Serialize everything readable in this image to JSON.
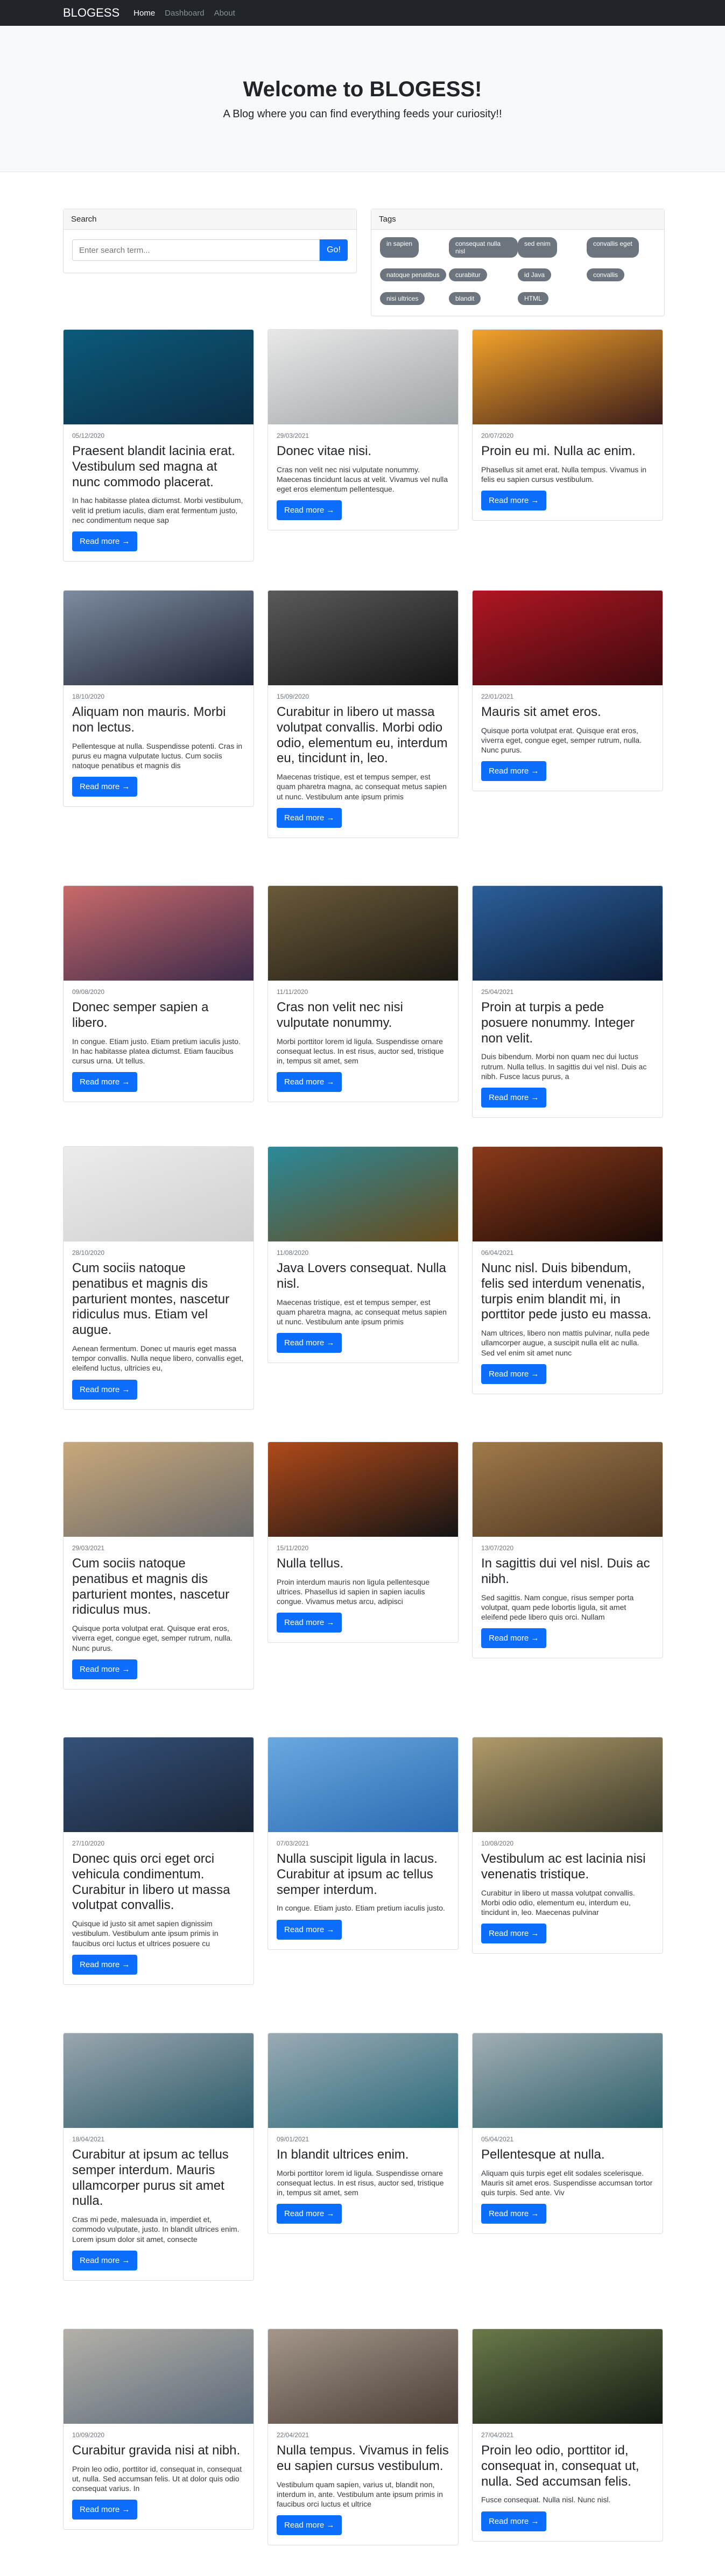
{
  "nav": {
    "brand": "BLOGESS",
    "links": [
      "Home",
      "Dashboard",
      "About"
    ]
  },
  "hero": {
    "title": "Welcome to BLOGESS!",
    "subtitle": "A Blog where you can find everything feeds your curiosity!!"
  },
  "search": {
    "header": "Search",
    "placeholder": "Enter search term...",
    "button": "Go!"
  },
  "tags": {
    "header": "Tags",
    "items": [
      "in sapien",
      "consequat nulla nisl",
      "sed enim",
      "convallis eget",
      "natoque penatibus",
      "curabitur",
      "id Java",
      "convallis",
      "nisi ultrices",
      "blandit",
      "HTML"
    ]
  },
  "read_more_label": "Read more →",
  "posts": [
    {
      "date": "05/12/2020",
      "title": "Praesent blandit lacinia erat. Vestibulum sed magna at nunc commodo placerat.",
      "excerpt": "In hac habitasse platea dictumst. Morbi vestibulum, velit id pretium iaculis, diam erat fermentum justo, nec condimentum neque sap",
      "colors": [
        "#0b5a7a",
        "#0c2e46"
      ]
    },
    {
      "date": "29/03/2021",
      "title": "Donec vitae nisi.",
      "excerpt": "Cras non velit nec nisi vulputate nonummy. Maecenas tincidunt lacus at velit. Vivamus vel nulla eget eros elementum pellentesque.",
      "colors": [
        "#e8e8e8",
        "#9ea3a6"
      ]
    },
    {
      "date": "20/07/2020",
      "title": "Proin eu mi. Nulla ac enim.",
      "excerpt": "Phasellus sit amet erat. Nulla tempus. Vivamus in felis eu sapien cursus vestibulum.",
      "colors": [
        "#f4a32a",
        "#3a1c1a"
      ]
    },
    {
      "date": "18/10/2020",
      "title": "Aliquam non mauris. Morbi non lectus.",
      "excerpt": "Pellentesque at nulla. Suspendisse potenti. Cras in purus eu magna vulputate luctus. Cum sociis natoque penatibus et magnis dis",
      "colors": [
        "#7d8ba0",
        "#1e2534"
      ]
    },
    {
      "date": "15/09/2020",
      "title": "Curabitur in libero ut massa volutpat convallis. Morbi odio odio, elementum eu, interdum eu, tincidunt in, leo.",
      "excerpt": "Maecenas tristique, est et tempus semper, est quam pharetra magna, ac consequat metus sapien ut nunc. Vestibulum ante ipsum primis",
      "colors": [
        "#5a5a5a",
        "#141414"
      ]
    },
    {
      "date": "22/01/2021",
      "title": "Mauris sit amet eros.",
      "excerpt": "Quisque porta volutpat erat. Quisque erat eros, viverra eget, congue eget, semper rutrum, nulla. Nunc purus.",
      "colors": [
        "#b01622",
        "#3c0a0e"
      ]
    },
    {
      "date": "09/08/2020",
      "title": "Donec semper sapien a libero.",
      "excerpt": "In congue. Etiam justo. Etiam pretium iaculis justo. In hac habitasse platea dictumst. Etiam faucibus cursus urna. Ut tellus.",
      "colors": [
        "#c96a6a",
        "#3b2a4a"
      ]
    },
    {
      "date": "11/11/2020",
      "title": "Cras non velit nec nisi vulputate nonummy.",
      "excerpt": "Morbi porttitor lorem id ligula. Suspendisse ornare consequat lectus. In est risus, auctor sed, tristique in, tempus sit amet, sem",
      "colors": [
        "#6b5a3a",
        "#1c1a12"
      ]
    },
    {
      "date": "25/04/2021",
      "title": "Proin at turpis a pede posuere nonummy. Integer non velit.",
      "excerpt": "Duis bibendum. Morbi non quam nec dui luctus rutrum. Nulla tellus. In sagittis dui vel nisl. Duis ac nibh. Fusce lacus purus, a",
      "colors": [
        "#2b5f9a",
        "#0c1c36"
      ]
    },
    {
      "date": "28/10/2020",
      "title": "Cum sociis natoque penatibus et magnis dis parturient montes, nascetur ridiculus mus. Etiam vel augue.",
      "excerpt": "Aenean fermentum. Donec ut mauris eget massa tempor convallis. Nulla neque libero, convallis eget, eleifend luctus, ultricies eu,",
      "colors": [
        "#ececec",
        "#cfcfcf"
      ]
    },
    {
      "date": "11/08/2020",
      "title": "Java Lovers consequat. Nulla nisl.",
      "excerpt": "Maecenas tristique, est et tempus semper, est quam pharetra magna, ac consequat metus sapien ut nunc. Vestibulum ante ipsum primis",
      "colors": [
        "#2a8a9a",
        "#6a4a1a"
      ]
    },
    {
      "date": "06/04/2021",
      "title": "Nunc nisl. Duis bibendum, felis sed interdum venenatis, turpis enim blandit mi, in porttitor pede justo eu massa.",
      "excerpt": "Nam ultrices, libero non mattis pulvinar, nulla pede ullamcorper augue, a suscipit nulla elit ac nulla. Sed vel enim sit amet nunc",
      "colors": [
        "#8a3a1a",
        "#1a0a06"
      ]
    },
    {
      "date": "29/03/2021",
      "title": "Cum sociis natoque penatibus et magnis dis parturient montes, nascetur ridiculus mus.",
      "excerpt": "Quisque porta volutpat erat. Quisque erat eros, viverra eget, congue eget, semper rutrum, nulla. Nunc purus.",
      "colors": [
        "#c9a87a",
        "#6a6a6a"
      ]
    },
    {
      "date": "15/11/2020",
      "title": "Nulla tellus.",
      "excerpt": "Proin interdum mauris non ligula pellentesque ultrices. Phasellus id sapien in sapien iaculis congue. Vivamus metus arcu, adipisci",
      "colors": [
        "#b04a1a",
        "#141414"
      ]
    },
    {
      "date": "13/07/2020",
      "title": "In sagittis dui vel nisl. Duis ac nibh.",
      "excerpt": "Sed sagittis. Nam congue, risus semper porta volutpat, quam pede lobortis ligula, sit amet eleifend pede libero quis orci. Nullam",
      "colors": [
        "#a07a4a",
        "#4a3420"
      ]
    },
    {
      "date": "27/10/2020",
      "title": "Donec quis orci eget orci vehicula condimentum. Curabitur in libero ut massa volutpat convallis.",
      "excerpt": "Quisque id justo sit amet sapien dignissim vestibulum. Vestibulum ante ipsum primis in faucibus orci luctus et ultrices posuere cu",
      "colors": [
        "#34527a",
        "#1a2436"
      ]
    },
    {
      "date": "07/03/2021",
      "title": "Nulla suscipit ligula in lacus. Curabitur at ipsum ac tellus semper interdum.",
      "excerpt": "In congue. Etiam justo. Etiam pretium iaculis justo.",
      "colors": [
        "#6aa8e0",
        "#2a6ab0"
      ]
    },
    {
      "date": "10/08/2020",
      "title": "Vestibulum ac est lacinia nisi venenatis tristique.",
      "excerpt": "Curabitur in libero ut massa volutpat convallis. Morbi odio odio, elementum eu, interdum eu, tincidunt in, leo. Maecenas pulvinar",
      "colors": [
        "#b09a6a",
        "#3a3a2a"
      ]
    },
    {
      "date": "18/04/2021",
      "title": "Curabitur at ipsum ac tellus semper interdum. Mauris ullamcorper purus sit amet nulla.",
      "excerpt": "Cras mi pede, malesuada in, imperdiet et, commodo vulputate, justo. In blandit ultrices enim. Lorem ipsum dolor sit amet, consecte",
      "colors": [
        "#9aa6ae",
        "#2a5a6a"
      ]
    },
    {
      "date": "09/01/2021",
      "title": "In blandit ultrices enim.",
      "excerpt": "Morbi porttitor lorem id ligula. Suspendisse ornare consequat lectus. In est risus, auctor sed, tristique in, tempus sit amet, sem",
      "colors": [
        "#9aaab4",
        "#2a6a7a"
      ]
    },
    {
      "date": "05/04/2021",
      "title": "Pellentesque at nulla.",
      "excerpt": "Aliquam quis turpis eget elit sodales scelerisque. Mauris sit amet eros. Suspendisse accumsan tortor quis turpis. Sed ante. Viv",
      "colors": [
        "#a2aeb4",
        "#2a5e6a"
      ]
    },
    {
      "date": "10/09/2020",
      "title": "Curabitur gravida nisi at nibh.",
      "excerpt": "Proin leo odio, porttitor id, consequat in, consequat ut, nulla. Sed accumsan felis. Ut at dolor quis odio consequat varius. In",
      "colors": [
        "#b4b0a8",
        "#5a6a7a"
      ]
    },
    {
      "date": "22/04/2021",
      "title": "Nulla tempus. Vivamus in felis eu sapien cursus vestibulum.",
      "excerpt": "Vestibulum quam sapien, varius ut, blandit non, interdum in, ante. Vestibulum ante ipsum primis in faucibus orci luctus et ultrice",
      "colors": [
        "#a4968a",
        "#4a3e36"
      ]
    },
    {
      "date": "27/04/2021",
      "title": "Proin leo odio, porttitor id, consequat in, consequat ut, nulla. Sed accumsan felis.",
      "excerpt": "Fusce consequat. Nulla nisl. Nunc nisl.",
      "colors": [
        "#6a7a4a",
        "#141a12"
      ]
    }
  ]
}
